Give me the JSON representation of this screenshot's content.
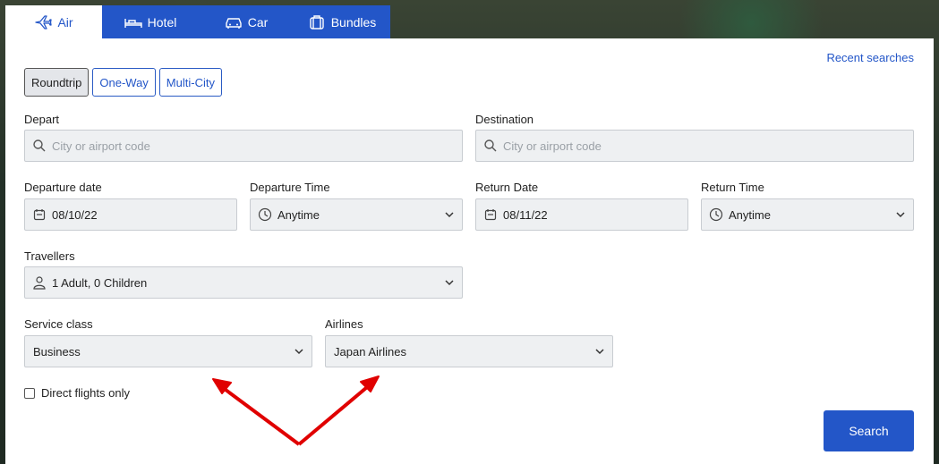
{
  "tabs": [
    {
      "label": "Air",
      "icon": "plane-icon"
    },
    {
      "label": "Hotel",
      "icon": "bed-icon"
    },
    {
      "label": "Car",
      "icon": "car-icon"
    },
    {
      "label": "Bundles",
      "icon": "suitcase-icon"
    }
  ],
  "recent_searches": "Recent searches",
  "trip_types": [
    "Roundtrip",
    "One-Way",
    "Multi-City"
  ],
  "depart": {
    "label": "Depart",
    "placeholder": "City or airport code"
  },
  "destination": {
    "label": "Destination",
    "placeholder": "City or airport code"
  },
  "departure_date": {
    "label": "Departure date",
    "value": "08/10/22"
  },
  "departure_time": {
    "label": "Departure Time",
    "value": "Anytime"
  },
  "return_date": {
    "label": "Return Date",
    "value": "08/11/22"
  },
  "return_time": {
    "label": "Return Time",
    "value": "Anytime"
  },
  "travellers": {
    "label": "Travellers",
    "value": "1 Adult, 0 Children"
  },
  "service_class": {
    "label": "Service class",
    "value": "Business"
  },
  "airlines": {
    "label": "Airlines",
    "value": "Japan Airlines"
  },
  "direct_only": "Direct flights only",
  "search_button": "Search",
  "colors": {
    "accent": "#2356c8",
    "annotation_arrow": "#e00000"
  }
}
